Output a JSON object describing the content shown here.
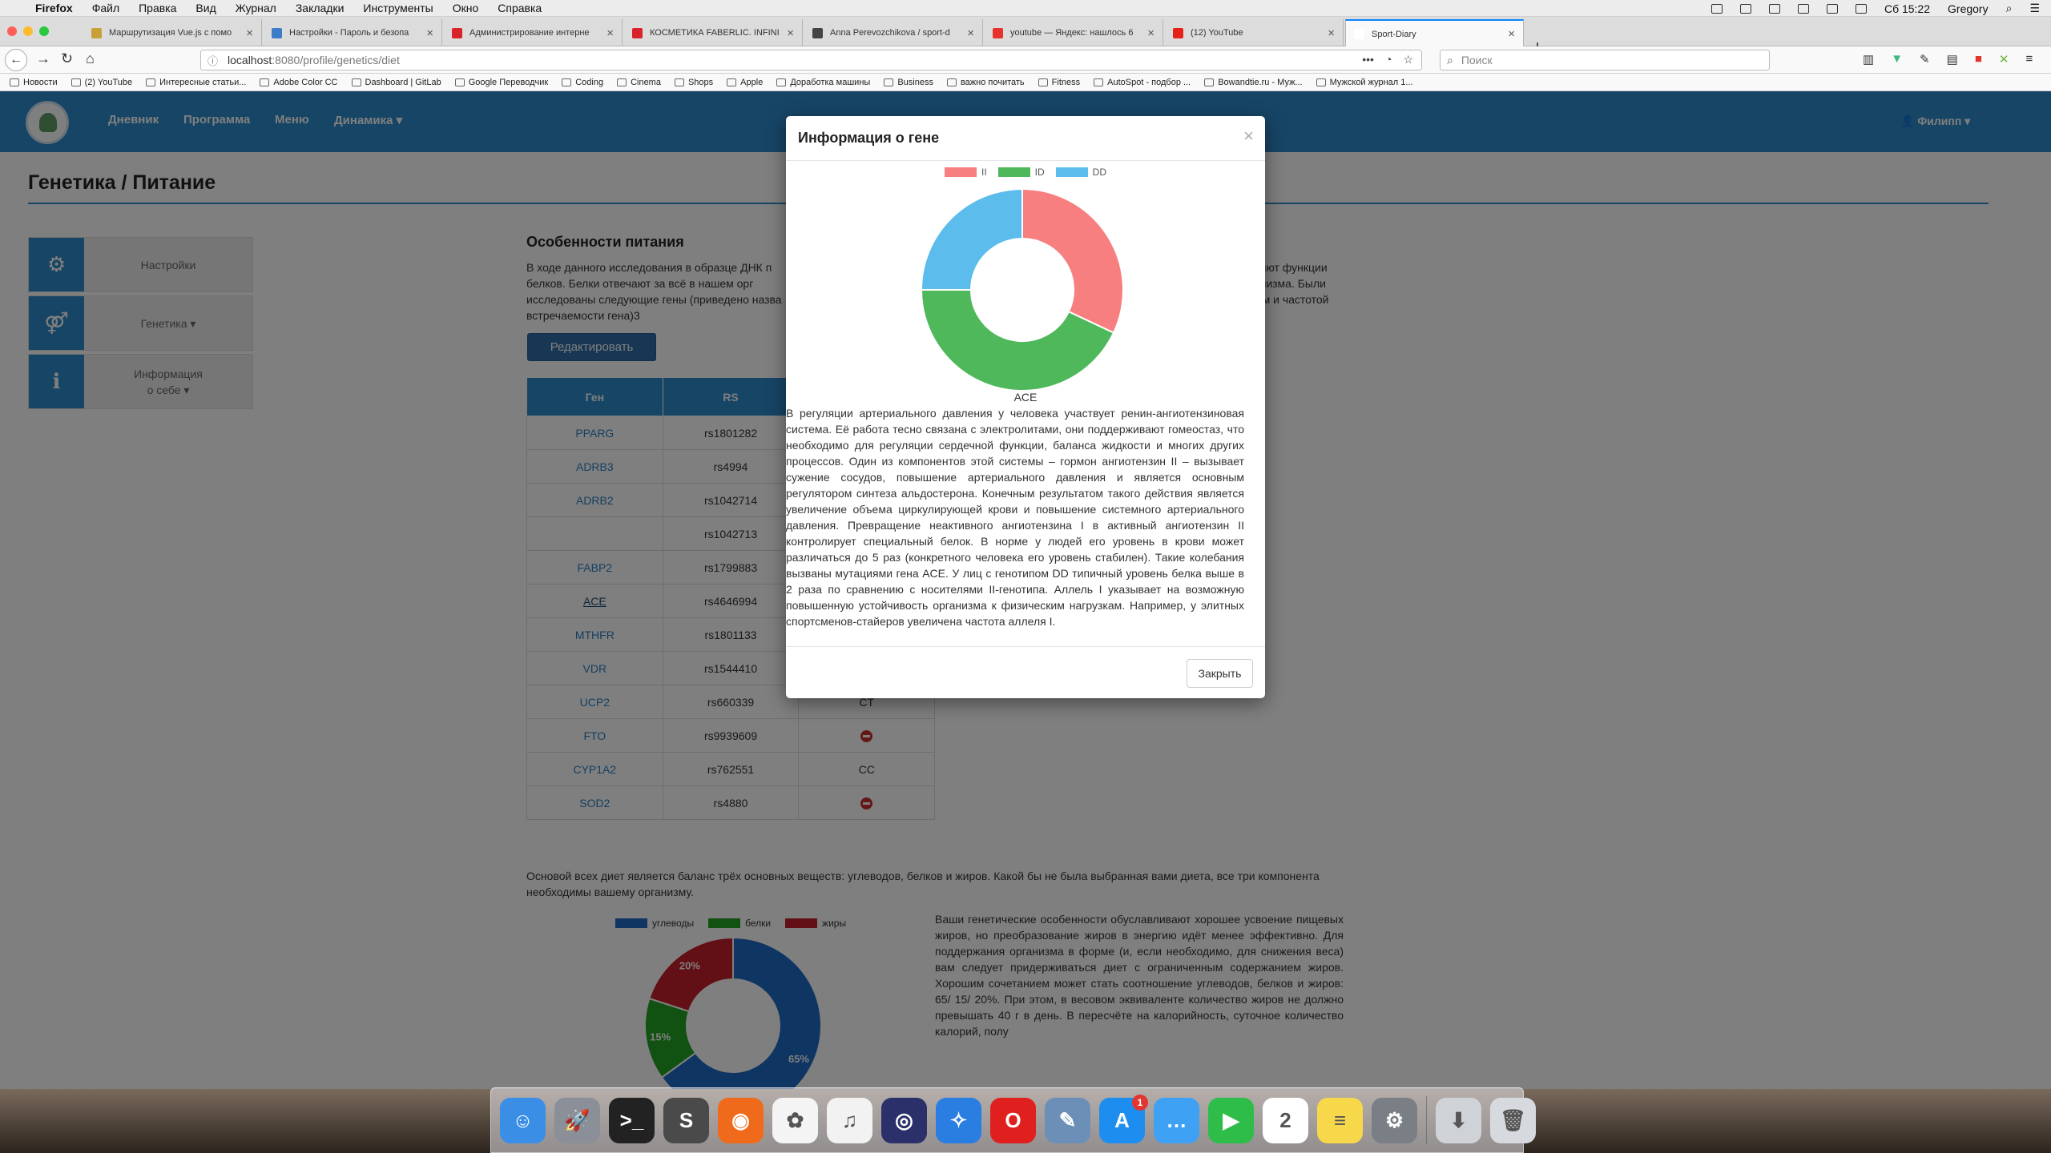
{
  "menubar": {
    "app": "Firefox",
    "items": [
      "Файл",
      "Правка",
      "Вид",
      "Журнал",
      "Закладки",
      "Инструменты",
      "Окно",
      "Справка"
    ],
    "clock": "Сб 15:22",
    "user": "Gregory"
  },
  "tabs": [
    {
      "title": "Маршрутизация Vue.js с помо",
      "color": "#c8a03a"
    },
    {
      "title": "Настройки - Пароль и безопа",
      "color": "#3d7cc9"
    },
    {
      "title": "Администрирование интерне",
      "color": "#d8232a"
    },
    {
      "title": "КОСМЕТИКА FABERLIC. INFINI",
      "color": "#d8232a"
    },
    {
      "title": "Anna Perevozchikova / sport-d",
      "color": "#444444"
    },
    {
      "title": "youtube — Яндекс: нашлось 6",
      "color": "#e8322d"
    },
    {
      "title": "(12) YouTube",
      "color": "#e62117"
    },
    {
      "title": "Sport-Diary",
      "color": "#ffffff"
    }
  ],
  "nav": {
    "url_host": "localhost",
    "url_rest": ":8080/profile/genetics/diet",
    "search_placeholder": "Поиск"
  },
  "bookmarks": [
    "Новости",
    "(2) YouTube",
    "Интересные статьи...",
    "Adobe Color CC",
    "Dashboard | GitLab",
    "Google Переводчик",
    "Coding",
    "Cinema",
    "Shops",
    "Apple",
    "Доработка машины",
    "Business",
    "важно почитать",
    "Fitness",
    "AutoSpot - подбор ...",
    "Bowandtie.ru - Муж...",
    "Мужской журнал 1..."
  ],
  "app": {
    "nav_links": [
      "Дневник",
      "Программа",
      "Меню",
      "Динамика ▾"
    ],
    "user_menu": "👤 Филипп ▾",
    "page_title": "Генетика / Питание",
    "sidebar": [
      {
        "icon": "⚙",
        "label": "Настройки"
      },
      {
        "icon": "⚤",
        "label": "Генетика ▾"
      },
      {
        "icon": "ℹ",
        "label": "Информация о себе ▾"
      }
    ],
    "section_title": "Особенности питания",
    "intro_left": "В ходе данного исследования в образце ДНК п",
    "intro_right": "няют функции",
    "intro_line2_left": "белков. Белки отвечают за всё в нашем орг",
    "intro_line2_right": "ганизма. Были",
    "intro_line3_left": "исследованы следующие гены (приведено назва",
    "intro_line3_right": "ием и частотой",
    "intro_line4": "встречаемости гена)3",
    "edit_button": "Редактировать",
    "table_headers": [
      "Ген",
      "RS",
      ""
    ],
    "table_rows": [
      {
        "gene": "PPARG",
        "rs": "rs1801282",
        "g": ""
      },
      {
        "gene": "ADRB3",
        "rs": "rs4994",
        "g": ""
      },
      {
        "gene": "ADRB2",
        "rs": "rs1042714",
        "g": ""
      },
      {
        "gene": "",
        "rs": "rs1042713",
        "g": ""
      },
      {
        "gene": "FABP2",
        "rs": "rs1799883",
        "g": ""
      },
      {
        "gene": "ACE",
        "rs": "rs4646994",
        "g": ""
      },
      {
        "gene": "MTHFR",
        "rs": "rs1801133",
        "g": ""
      },
      {
        "gene": "VDR",
        "rs": "rs1544410",
        "g": ""
      },
      {
        "gene": "UCP2",
        "rs": "rs660339",
        "g": "CT"
      },
      {
        "gene": "FTO",
        "rs": "rs9939609",
        "g": "minus"
      },
      {
        "gene": "CYP1A2",
        "rs": "rs762551",
        "g": "CC"
      },
      {
        "gene": "SOD2",
        "rs": "rs4880",
        "g": "minus"
      }
    ],
    "balance_text": "Основой всех диет является баланс трёх основных веществ: углеводов, белков и жиров. Какой бы не была выбранная вами диета, все три компонента необходимы вашему организму.",
    "genetic_text": "Ваши генетические особенности обуславливают хорошее усвоение пищевых жиров, но преобразование жиров в энергию идёт менее эффективно. Для поддержания организма в форме (и, если необходимо, для снижения веса) вам следует придерживаться диет с ограниченным содержанием жиров. Хорошим сочетанием может стать соотношение углеводов, белков и жиров: 65/ 15/ 20%. При этом, в весовом эквиваленте количество жиров не должно превышать 40 г в день. В пересчёте на калорийность, суточное количество калорий, полу"
  },
  "modal": {
    "title": "Информация о гене",
    "close_x": "×",
    "gene": "ACE",
    "description": "В регуляции артериального давления у человека участвует ренин-ангиотензиновая система. Её работа тесно связана с электролитами, они поддерживают гомеостаз, что необходимо для регуляции сердечной функции, баланса жидкости и многих других процессов. Один из компонентов этой системы – гормон ангиотензин II – вызывает сужение сосудов, повышение артериального давления и является основным регулятором синтеза альдостерона. Конечным результатом такого действия является увеличение объема циркулирующей крови и повышение системного артериального давления. Превращение неактивного ангиотензина I в активный ангиотензин II контролирует специальный белок. В норме у людей его уровень в крови может различаться до 5 раз (конкретного человека его уровень стабилен). Такие колебания вызваны мутациями гена ACE. У лиц с генотипом DD типичный уровень белка выше в 2 раза по сравнению с носителями II-генотипа. Аллель I указывает на возможную повышенную устойчивость организма к физическим нагрузкам. Например, у элитных спортсменов-стайеров увеличена частота аллеля I.",
    "close_button": "Закрыть"
  },
  "chart_data": [
    {
      "type": "pie",
      "categories": [
        "II",
        "ID",
        "DD"
      ],
      "values": [
        32,
        43,
        25
      ],
      "colors": [
        "#f77f7f",
        "#4fb85a",
        "#5cbcec"
      ],
      "title": "ACE",
      "legend": "top"
    },
    {
      "type": "pie",
      "categories": [
        "углеводы",
        "белки",
        "жиры"
      ],
      "values": [
        65,
        15,
        20
      ],
      "labels": [
        "65%",
        "15%",
        "20%"
      ],
      "colors": [
        "#1e6bc7",
        "#23a323",
        "#c41e2b"
      ],
      "legend": "top"
    }
  ],
  "dock": [
    {
      "name": "finder-icon",
      "color": "#3a8ee6",
      "glyph": "☺"
    },
    {
      "name": "launchpad-icon",
      "color": "#8a8f98",
      "glyph": "🚀"
    },
    {
      "name": "terminal-icon",
      "color": "#222222",
      "glyph": ">_"
    },
    {
      "name": "sublime-text-icon",
      "color": "#4a4a4a",
      "glyph": "S"
    },
    {
      "name": "firefox-icon",
      "color": "#f06a1c",
      "glyph": "◉"
    },
    {
      "name": "photos-icon",
      "color": "#f4f4f4",
      "glyph": "✿"
    },
    {
      "name": "music-icon",
      "color": "#f2f2f2",
      "glyph": "♫"
    },
    {
      "name": "siri-icon",
      "color": "#2b2f6a",
      "glyph": "◎"
    },
    {
      "name": "safari-icon",
      "color": "#2a7de1",
      "glyph": "✧"
    },
    {
      "name": "opera-icon",
      "color": "#e0201f",
      "glyph": "O"
    },
    {
      "name": "preview-icon",
      "color": "#6c8fb7",
      "glyph": "✎"
    },
    {
      "name": "app-store-icon",
      "color": "#1d8ef0",
      "glyph": "A",
      "badge": "1"
    },
    {
      "name": "messages-icon",
      "color": "#3fa1f4",
      "glyph": "…"
    },
    {
      "name": "facetime-icon",
      "color": "#2fbd4a",
      "glyph": "▶"
    },
    {
      "name": "calendar-icon",
      "color": "#ffffff",
      "glyph": "2"
    },
    {
      "name": "notes-icon",
      "color": "#f7d84b",
      "glyph": "≡"
    },
    {
      "name": "system-preferences-icon",
      "color": "#7a7f86",
      "glyph": "⚙"
    },
    {
      "name": "downloads-icon",
      "color": "#cfd3d8",
      "glyph": "⬇"
    },
    {
      "name": "trash-icon",
      "color": "#d6d9dd",
      "glyph": "🗑"
    }
  ]
}
